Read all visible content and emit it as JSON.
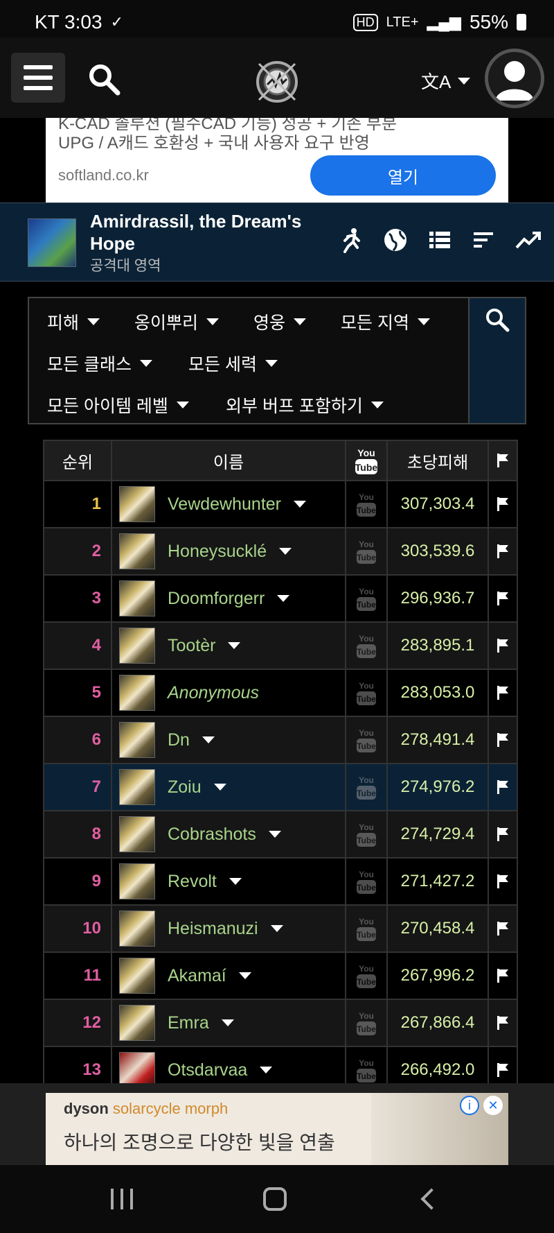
{
  "status_bar": {
    "carrier_time": "KT 3:03",
    "network": "LTE+",
    "battery": "55%"
  },
  "app_bar": {
    "language_icon": "translate-icon"
  },
  "top_ad": {
    "line1": "K-CAD 솔루션 (필수CAD 기능) 성공 + 기존 부분",
    "line2": "UPG / A캐드 호환성 + 국내 사용자 요구 반영",
    "domain": "softland.co.kr",
    "open_button": "열기"
  },
  "zone": {
    "title": "Amirdrassil, the Dream's Hope",
    "subtitle": "공격대 영역"
  },
  "filters": {
    "metric": "피해",
    "boss": "옹이뿌리",
    "difficulty": "영웅",
    "region": "모든 지역",
    "class": "모든 클래스",
    "faction": "모든 세력",
    "item_level": "모든 아이템 레벨",
    "buffs": "외부 버프 포함하기"
  },
  "table": {
    "headers": {
      "rank": "순위",
      "name": "이름",
      "dps": "초당피해"
    },
    "rows": [
      {
        "rank": "1",
        "name": "Vewdewhunter",
        "dps": "307,303.4"
      },
      {
        "rank": "2",
        "name": "Honeysucklé",
        "dps": "303,539.6"
      },
      {
        "rank": "3",
        "name": "Doomforgerr",
        "dps": "296,936.7"
      },
      {
        "rank": "4",
        "name": "Tootèr",
        "dps": "283,895.1"
      },
      {
        "rank": "5",
        "name": "Anonymous",
        "dps": "283,053.0"
      },
      {
        "rank": "6",
        "name": "Dn",
        "dps": "278,491.4"
      },
      {
        "rank": "7",
        "name": "Zoiu",
        "dps": "274,976.2"
      },
      {
        "rank": "8",
        "name": "Cobrashots",
        "dps": "274,729.4"
      },
      {
        "rank": "9",
        "name": "Revolt",
        "dps": "271,427.2"
      },
      {
        "rank": "10",
        "name": "Heismanuzi",
        "dps": "270,458.4"
      },
      {
        "rank": "11",
        "name": "Akamaí",
        "dps": "267,996.2"
      },
      {
        "rank": "12",
        "name": "Emra",
        "dps": "267,866.4"
      },
      {
        "rank": "13",
        "name": "Otsdarvaa",
        "dps": "266,492.0"
      }
    ]
  },
  "bottom_ad": {
    "brand": "dyson",
    "product": "solarcycle morph",
    "copy": "하나의 조명으로 다양한 빛을 연출"
  },
  "colors": {
    "highlight_row": "#0b2236",
    "rank_pink": "#e05fa1",
    "rank_gold": "#e8c24a",
    "name_green": "#a8d48a"
  }
}
